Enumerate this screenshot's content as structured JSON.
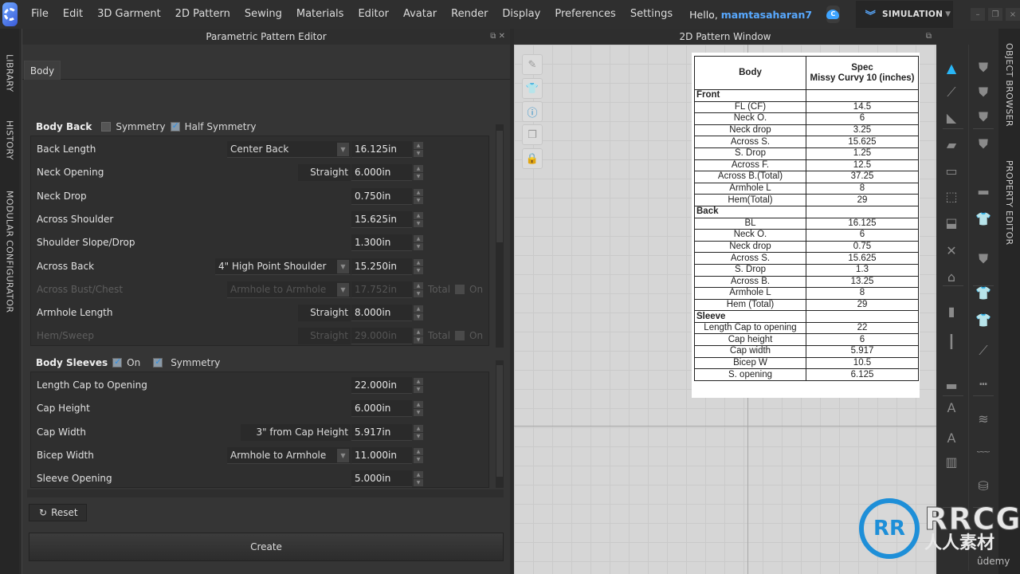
{
  "menubar": {
    "items": [
      "File",
      "Edit",
      "3D Garment",
      "2D Pattern",
      "Sewing",
      "Materials",
      "Editor",
      "Avatar",
      "Render",
      "Display",
      "Preferences",
      "Settings"
    ],
    "greeting_prefix": "Hello, ",
    "username": "mamtasaharan7",
    "cloud_icon_letter": "C",
    "mode_label": "SIMULATION",
    "mode_icon": "double-chevron-down-icon",
    "window_controls": [
      "–",
      "❐",
      "×"
    ]
  },
  "left_dock": {
    "tabs": [
      "LIBRARY",
      "HISTORY",
      "MODULAR CONFIGURATOR"
    ]
  },
  "right_dock": {
    "tabs": [
      "OBJECT BROWSER",
      "PROPERTY EDITOR"
    ]
  },
  "parametric_editor": {
    "title": "Parametric Pattern Editor",
    "title_icons": "⧉ ✕",
    "tab": "Body",
    "body_back": {
      "title": "Body Back",
      "symmetry_label": "Symmetry",
      "symmetry_checked": false,
      "half_symmetry_label": "Half Symmetry",
      "half_symmetry_checked": true,
      "rows": [
        {
          "label": "Back Length",
          "option": "Center Back",
          "option_type": "dropdown",
          "value": "16.125in",
          "enabled": true
        },
        {
          "label": "Neck Opening",
          "option": "Straight",
          "option_type": "fixed",
          "value": "6.000in",
          "enabled": true
        },
        {
          "label": "Neck Drop",
          "option": "",
          "option_type": "none",
          "value": "0.750in",
          "enabled": true
        },
        {
          "label": "Across Shoulder",
          "option": "",
          "option_type": "none",
          "value": "15.625in",
          "enabled": true
        },
        {
          "label": "Shoulder Slope/Drop",
          "option": "",
          "option_type": "none",
          "value": "1.300in",
          "enabled": true
        },
        {
          "label": "Across Back",
          "option": "4\" High Point Shoulder",
          "option_type": "dropdown",
          "value": "15.250in",
          "enabled": true
        },
        {
          "label": "Across Bust/Chest",
          "option": "Armhole to Armhole",
          "option_type": "dropdown",
          "value": "17.752in",
          "enabled": false,
          "total_label": "Total",
          "on_label": "On"
        },
        {
          "label": "Armhole Length",
          "option": "Straight",
          "option_type": "fixed",
          "value": "8.000in",
          "enabled": true
        },
        {
          "label": "Hem/Sweep",
          "option": "Straight",
          "option_type": "fixed",
          "value": "29.000in",
          "enabled": false,
          "total_label": "Total",
          "on_label": "On"
        }
      ]
    },
    "body_sleeves": {
      "title": "Body Sleeves",
      "on_label": "On",
      "on_checked": true,
      "symmetry_label": "Symmetry",
      "symmetry_checked": true,
      "rows": [
        {
          "label": "Length Cap to Opening",
          "option": "",
          "option_type": "none",
          "value": "22.000in",
          "enabled": true
        },
        {
          "label": "Cap Height",
          "option": "",
          "option_type": "none",
          "value": "6.000in",
          "enabled": true
        },
        {
          "label": "Cap Width",
          "option": "3\" from Cap Height",
          "option_type": "fixed",
          "value": "5.917in",
          "enabled": true
        },
        {
          "label": "Bicep Width",
          "option": "Armhole to Armhole",
          "option_type": "dropdown",
          "value": "11.000in",
          "enabled": true
        },
        {
          "label": "Sleeve Opening",
          "option": "",
          "option_type": "none",
          "value": "5.000in",
          "enabled": true
        }
      ]
    },
    "reset_label": "Reset",
    "reset_icon": "↻",
    "create_label": "Create"
  },
  "pattern_window": {
    "title": "2D Pattern Window",
    "title_icon": "⧉",
    "side_tools": [
      "show-needle-icon",
      "show-garment-icon",
      "info-icon",
      "layer-icon",
      "lock-garment-icon"
    ],
    "spec_table": {
      "header_col1": "Body",
      "header_col2_line1": "Spec",
      "header_col2_line2": "Missy Curvy 10 (inches)",
      "sections": [
        {
          "name": "Front",
          "rows": [
            [
              "FL (CF)",
              "14.5"
            ],
            [
              "Neck O.",
              "6"
            ],
            [
              "Neck drop",
              "3.25"
            ],
            [
              "Across S.",
              "15.625"
            ],
            [
              "S. Drop",
              "1.25"
            ],
            [
              "Across F.",
              "12.5"
            ],
            [
              "Across B.(Total)",
              "37.25"
            ],
            [
              "Armhole L",
              "8"
            ],
            [
              "Hem(Total)",
              "29"
            ]
          ]
        },
        {
          "name": "Back",
          "rows": [
            [
              "BL",
              "16.125"
            ],
            [
              "Neck O.",
              "6"
            ],
            [
              "Neck drop",
              "0.75"
            ],
            [
              "Across S.",
              "15.625"
            ],
            [
              "S. Drop",
              "1.3"
            ],
            [
              "Across B.",
              "13.25"
            ],
            [
              "Armhole L",
              "8"
            ],
            [
              "Hem (Total)",
              "29"
            ]
          ]
        },
        {
          "name": "Sleeve",
          "rows": [
            [
              "Length Cap to opening",
              "22"
            ],
            [
              "Cap height",
              "6"
            ],
            [
              "Cap width",
              "5.917"
            ],
            [
              "Bicep W",
              "10.5"
            ],
            [
              "S. opening",
              "6.125"
            ]
          ]
        }
      ]
    }
  },
  "right_tools": {
    "col1": [
      "▲",
      "⟋",
      "◣",
      "▰",
      "▭",
      "⬚",
      "⬓",
      "✕",
      "⌂",
      "▮",
      "┃",
      "▬",
      "A",
      "A",
      "▥"
    ],
    "col2": [
      "⛊",
      "⛊",
      "⛊",
      "⛊",
      "▂",
      "👕",
      "⛊",
      "👕",
      "👕",
      "⟋",
      "┅",
      "≋",
      "﹏",
      "⛁"
    ]
  },
  "watermark": {
    "logo_text": "RR",
    "brand": "RRCG",
    "cn": "人人素材",
    "udemy": "ûdemy"
  },
  "colors": {
    "accent": "#58a9ff",
    "active_tool": "#29b6f6",
    "panel_bg": "#353535",
    "canvas_bg": "#d6d6d6"
  }
}
